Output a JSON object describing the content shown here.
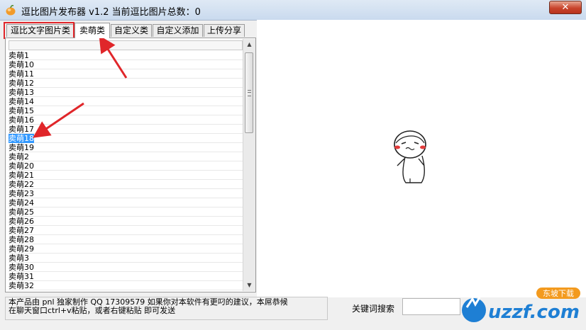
{
  "window": {
    "title": "逗比图片发布器 v1.2 当前逗比图片总数：0",
    "close_label": "✕"
  },
  "tabs": [
    "逗比文字图片类",
    "卖萌类",
    "自定义类",
    "自定义添加",
    "上传分享"
  ],
  "list": {
    "items": [
      "卖萌1",
      "卖萌10",
      "卖萌11",
      "卖萌12",
      "卖萌13",
      "卖萌14",
      "卖萌15",
      "卖萌16",
      "卖萌17",
      "卖萌18",
      "卖萌19",
      "卖萌2",
      "卖萌20",
      "卖萌21",
      "卖萌22",
      "卖萌23",
      "卖萌24",
      "卖萌25",
      "卖萌26",
      "卖萌27",
      "卖萌28",
      "卖萌29",
      "卖萌3",
      "卖萌30",
      "卖萌31",
      "卖萌32"
    ],
    "selected": "卖萌18"
  },
  "info": {
    "line1": "本产品由 pnl 独家制作 QQ 17309579  如果你对本软件有更叼的建议，本屌恭候",
    "line2": "在聊天窗口ctrl+v粘贴，或者右键粘贴 即可发送"
  },
  "keyword": {
    "label": "关键词搜索",
    "value": ""
  },
  "watermark": {
    "logo": "uzzf.com",
    "tag": "东坡下载"
  },
  "colors": {
    "annotation": "#e0262a",
    "selection": "#3399ff",
    "watermark_blue": "#1e7fd4",
    "watermark_orange": "#f39a1e"
  }
}
